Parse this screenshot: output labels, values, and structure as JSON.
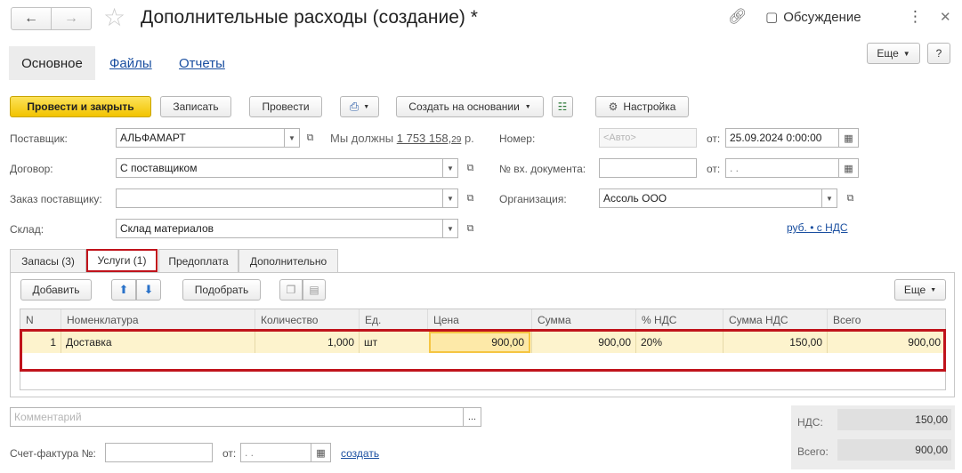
{
  "window": {
    "title": "Дополнительные расходы (создание) *",
    "discussion_label": "Обсуждение",
    "more_label": "Еще",
    "help_label": "?"
  },
  "nav_tabs": [
    {
      "label": "Основное"
    },
    {
      "label": "Файлы"
    },
    {
      "label": "Отчеты"
    }
  ],
  "toolbar": {
    "post_close": "Провести и закрыть",
    "write": "Записать",
    "post": "Провести",
    "create_based": "Создать на основании",
    "settings": "Настройка"
  },
  "form": {
    "supplier_label": "Поставщик:",
    "supplier_value": "АЛЬФАМАРТ",
    "debt_prefix": "Мы должны",
    "debt_amount": "1 753 158,",
    "debt_cents": "29",
    "debt_suffix": "р.",
    "contract_label": "Договор:",
    "contract_value": "С поставщиком",
    "order_label": "Заказ поставщику:",
    "order_value": "",
    "warehouse_label": "Склад:",
    "warehouse_value": "Склад материалов",
    "number_label": "Номер:",
    "number_placeholder": "<Авто>",
    "from_label": "от:",
    "date_value": "25.09.2024  0:00:00",
    "incoming_doc_label": "№ вх. документа:",
    "incoming_doc_value": "",
    "incoming_from_label": "от:",
    "incoming_date_value": " .  .",
    "org_label": "Организация:",
    "org_value": "Ассоль ООО",
    "currency_link": "руб. • с НДС"
  },
  "doc_tabs": [
    {
      "label": "Запасы (3)"
    },
    {
      "label": "Услуги (1)"
    },
    {
      "label": "Предоплата"
    },
    {
      "label": "Дополнительно"
    }
  ],
  "table_toolbar": {
    "add": "Добавить",
    "pick": "Подобрать",
    "more": "Еще"
  },
  "table": {
    "headers": [
      "N",
      "Номенклатура",
      "Количество",
      "Ед.",
      "Цена",
      "Сумма",
      "% НДС",
      "Сумма НДС",
      "Всего"
    ],
    "rows": [
      {
        "n": "1",
        "item": "Доставка",
        "qty": "1,000",
        "unit": "шт",
        "price": "900,00",
        "sum": "900,00",
        "vat_rate": "20%",
        "vat_sum": "150,00",
        "total": "900,00"
      }
    ]
  },
  "footer": {
    "comment_placeholder": "Комментарий",
    "comment_btn": "...",
    "invoice_label": "Счет-фактура №:",
    "invoice_from": "от:",
    "invoice_date": " .  .",
    "create_link": "создать",
    "vat_label": "НДС:",
    "vat_value": "150,00",
    "total_label": "Всего:",
    "total_value": "900,00"
  },
  "colors": {
    "accent_yellow": "#f5cb10",
    "highlight_red": "#c0131b",
    "selected_row": "#fdf3cd",
    "link_blue": "#1a4fa0"
  }
}
